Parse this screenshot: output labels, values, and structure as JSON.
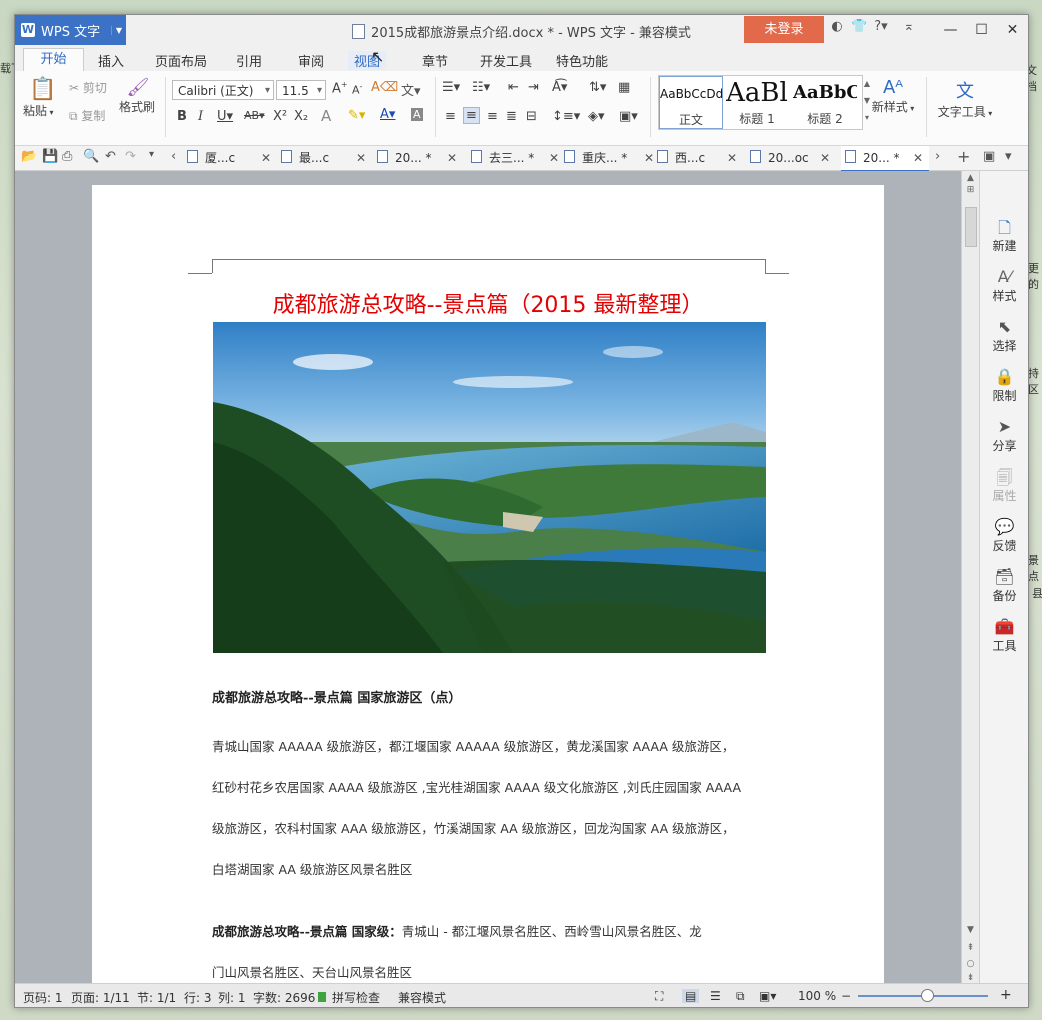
{
  "window": {
    "app_name": "WPS 文字",
    "title": "2015成都旅游景点介绍.docx * - WPS 文字 - 兼容模式",
    "login_label": "未登录",
    "controls": [
      "—",
      "☐",
      "✕"
    ]
  },
  "menu": {
    "tabs": [
      "开始",
      "插入",
      "页面布局",
      "引用",
      "审阅",
      "视图",
      "章节",
      "开发工具",
      "特色功能"
    ],
    "active": "开始",
    "hovered": "视图"
  },
  "ribbon": {
    "paste": "粘贴",
    "cut": "剪切",
    "copy": "复制",
    "format_painter": "格式刷",
    "font_name": "Calibri (正文)",
    "font_size": "11.5",
    "styles": [
      {
        "preview": "AaBbCcDd",
        "name": "正文"
      },
      {
        "preview": "AaBl",
        "name": "标题 1"
      },
      {
        "preview": "AaBbC",
        "name": "标题 2"
      }
    ],
    "new_style": "新样式",
    "text_tools": "文字工具"
  },
  "doc_tabs": [
    {
      "label": "厦...c"
    },
    {
      "label": "最...c"
    },
    {
      "label": "20... *"
    },
    {
      "label": "去三... *"
    },
    {
      "label": "重庆... *"
    },
    {
      "label": "西...c"
    },
    {
      "label": "20...oc"
    },
    {
      "label": "20... *"
    }
  ],
  "document": {
    "heading": "成都旅游总攻略--景点篇（2015 最新整理）",
    "section1_title": "成都旅游总攻略--景点篇  国家旅游区（点）",
    "section1_lines": [
      "青城山国家 AAAAA 级旅游区，都江堰国家 AAAAA 级旅游区，黄龙溪国家 AAAA 级旅游区，",
      "红砂村花乡农居国家 AAAA 级旅游区 ,宝光桂湖国家 AAAA 级文化旅游区 ,刘氏庄园国家 AAAA",
      "级旅游区，农科村国家 AAA 级旅游区，竹溪湖国家 AA 级旅游区，回龙沟国家 AA 级旅游区，",
      "白塔湖国家 AA 级旅游区风景名胜区"
    ],
    "section2_bold": "成都旅游总攻略--景点篇  国家级：",
    "section2_line1": "青城山 - 都江堰风景名胜区、西岭雪山风景名胜区、龙",
    "section2_line2": "门山风景名胜区、天台山风景名胜区"
  },
  "right_panel": [
    "新建",
    "样式",
    "选择",
    "限制",
    "分享",
    "属性",
    "反馈",
    "备份",
    "工具"
  ],
  "status": {
    "page_num": "页码: 1",
    "pages": "页面: 1/11",
    "section": "节: 1/1",
    "row": "行: 3",
    "col": "列: 1",
    "words": "字数: 2696",
    "spell": "拼写检查",
    "mode": "兼容模式",
    "zoom": "100 %",
    "zoom_fraction": 0.5
  },
  "desktop_fragments": [
    "载下",
    "更的",
    "持区",
    "景点",
    "县",
    "文档"
  ]
}
